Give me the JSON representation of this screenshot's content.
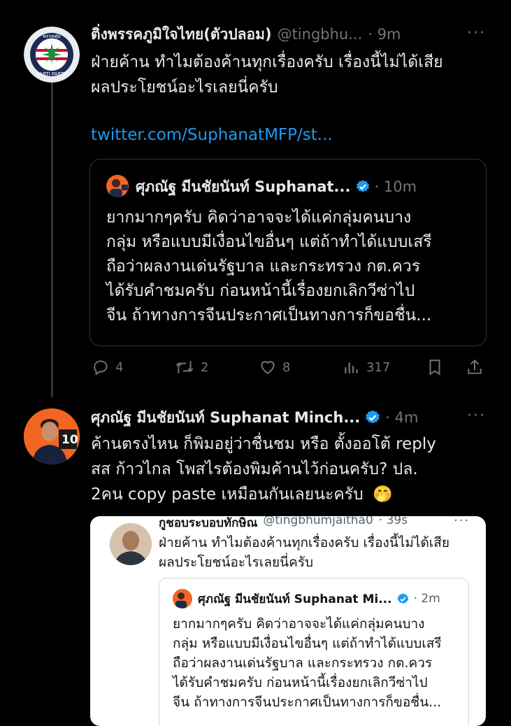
{
  "tweet1": {
    "display_name": "ติ่งพรรคภูมิใจไทย(ตัวปลอม)",
    "handle": "@tingbhu...",
    "time": "· 9m",
    "text_line1": "ฝ่ายค้าน ทำไมต้องค้านทุกเรื่องครับ เรื่องนี้ไม่ได้เสีย",
    "text_line2": "ผลประโยชน์อะไรเลยนี่ครับ",
    "link": "twitter.com/SuphanatMFP/st...",
    "avatar_ring_top": "พรรคตุ๋ย",
    "avatar_ring_bottom": "PARTI PARTY"
  },
  "quote1": {
    "display_name": "ศุภณัฐ มีนชัยนันท์ Suphanat...",
    "time": "· 10m",
    "lines": [
      "ยากมากๆครับ คิดว่าอาจจะได้แค่กลุ่มคนบาง",
      "กลุ่ม หรือแบบมีเงื่อนไขอื่นๆ แต่ถ้าทำได้แบบเสรี",
      "ถือว่าผลงานเด่นรัฐบาล และกระทรวง กต.ควร",
      "ได้รับคำชมครับ ก่อนหน้านี้เรื่องยกเลิกวีซ่าไป",
      "จีน ถ้าทางการจีนประกาศเป็นทางการก็ขอชื่น..."
    ]
  },
  "actions": {
    "replies": "4",
    "retweets": "2",
    "likes": "8",
    "views": "317"
  },
  "tweet2": {
    "display_name": "ศุภณัฐ มีนชัยนันท์ Suphanat Minch...",
    "time": "· 4m",
    "line1": "ค้านตรงไหน ก็พิมอยู่ว่าชื่นชม หรือ ตั้งออโต้ reply",
    "line2": "สส ก้าวไกล โพสไรต้องพิมค้านไว้ก่อนครับ? ปล.",
    "line3": "2คน copy paste เหมือนกันเลยนะครับ",
    "emoji": "🤭",
    "avatar_badge": "10"
  },
  "screenshot": {
    "display_name": "กูชอบระบอบทักษิณ",
    "handle": "@tingbhumjaitha0",
    "time": "· 39s",
    "text_line1": "ฝ่ายค้าน ทำไมต้องค้านทุกเรื่องครับ เรื่องนี้ไม่ได้เสีย",
    "text_line2": "ผลประโยชน์อะไรเลยนี่ครับ",
    "quote_name": "ศุภณัฐ มีนชัยนันท์ Suphanat Mi...",
    "quote_time": "· 2m",
    "quote_lines": [
      "ยากมากๆครับ คิดว่าอาจจะได้แค่กลุ่มคนบาง",
      "กลุ่ม หรือแบบมีเงื่อนไขอื่นๆ แต่ถ้าทำได้แบบเสรี",
      "ถือว่าผลงานเด่นรัฐบาล และกระทรวง กต.ควร",
      "ได้รับคำชมครับ ก่อนหน้านี้เรื่องยกเลิกวีซ่าไป",
      "จีน ถ้าทางการจีนประกาศเป็นทางการก็ขอชื่น..."
    ]
  },
  "colors": {
    "background": "#000000",
    "link": "#1d9bf0",
    "muted": "#71767b",
    "verified": "#1d9bf0",
    "avatar2_bg": "#f26522"
  }
}
